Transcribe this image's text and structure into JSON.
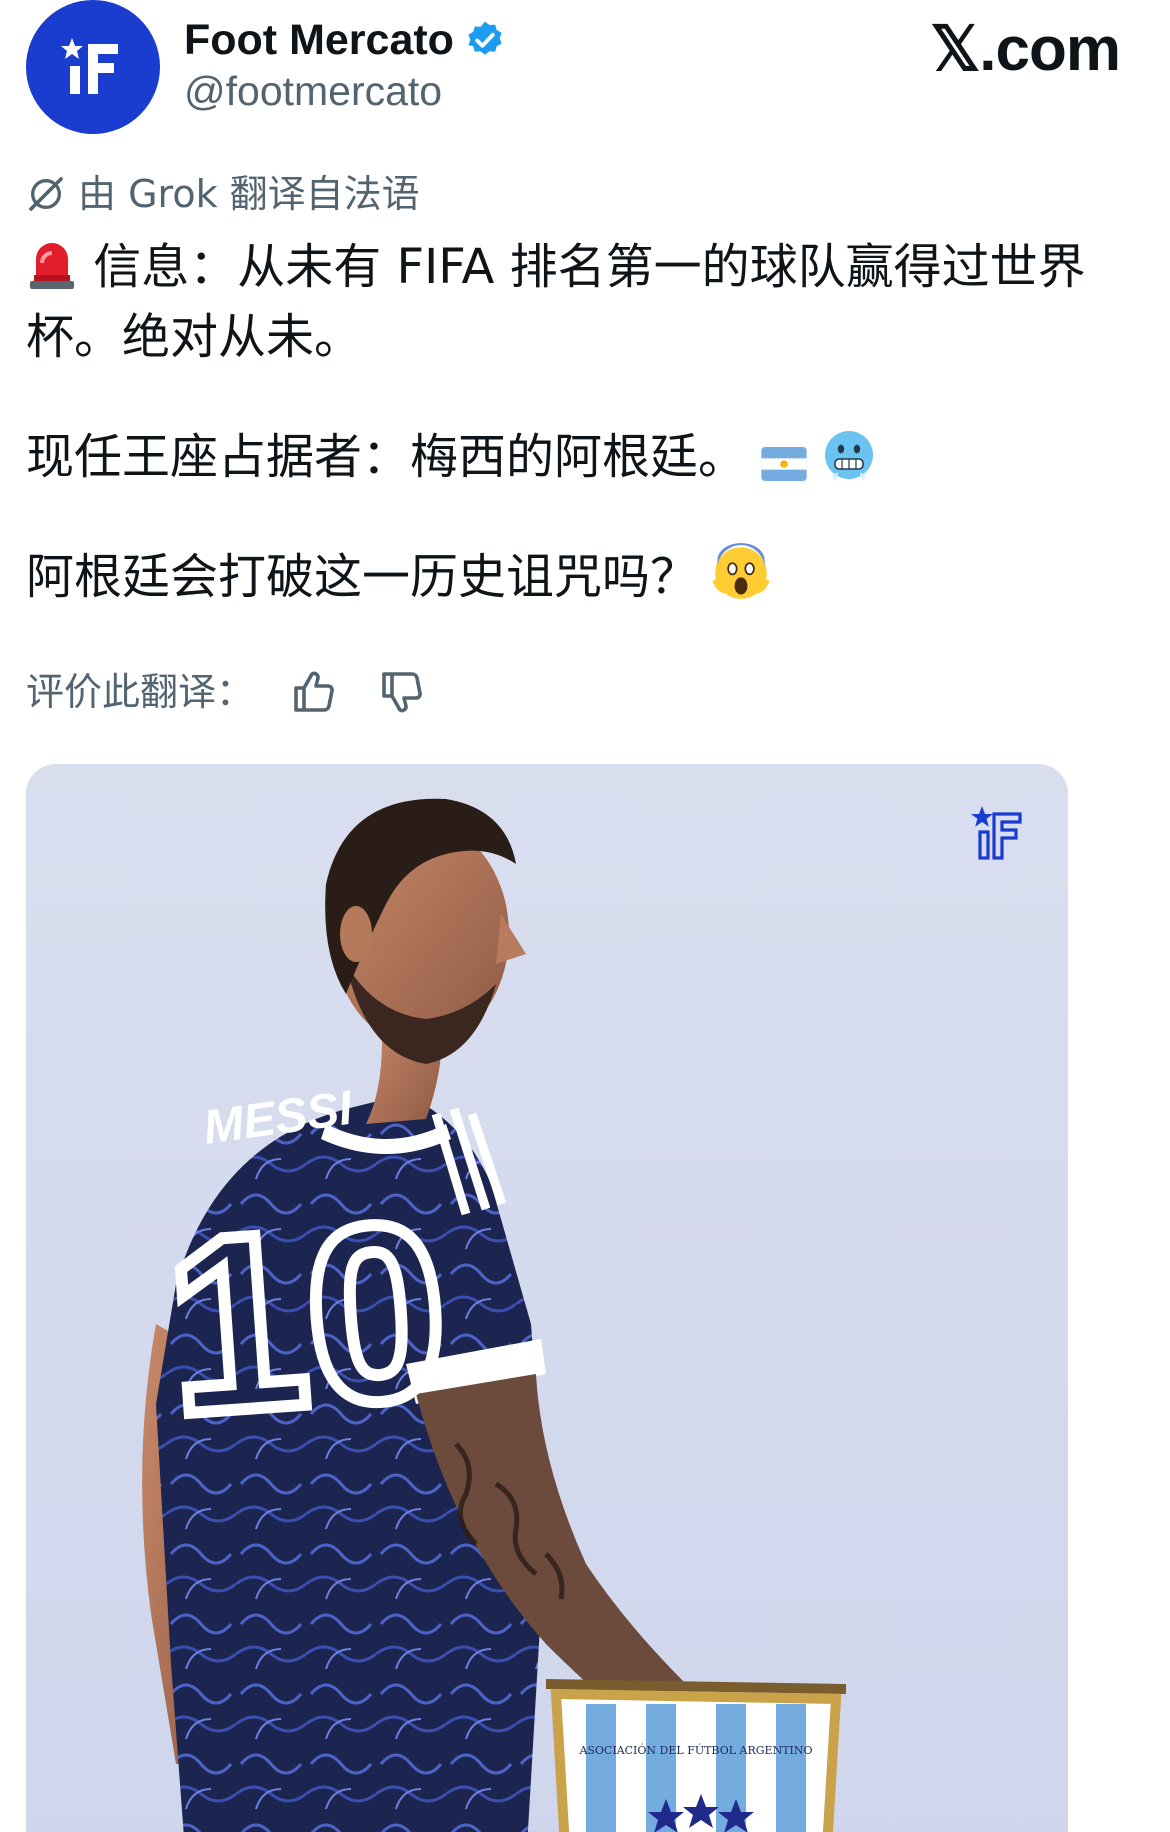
{
  "author": {
    "display_name": "Foot Mercato",
    "handle": "@footmercato",
    "avatar_color": "#1a3ccf",
    "verified": true
  },
  "site": {
    "logo_text": "𝕏.com"
  },
  "translation": {
    "label": "由 Grok 翻译自法语",
    "rate_label": "评价此翻译："
  },
  "tweet": {
    "line1": "信息：从未有 FIFA 排名第一的球队赢得过世界杯。绝对从未。",
    "line2": "现任王座占据者：梅西的阿根廷。",
    "line3": "阿根廷会打破这一历史诅咒吗？"
  },
  "media": {
    "jersey_name": "MESSI",
    "jersey_number": "10",
    "pennant_text": "ASOCIACIÓN DEL FÚTBOL ARGENTINO",
    "background_color": "#d6dcef"
  },
  "icons": {
    "avatar": "foot-mercato-logo",
    "verified": "verified-badge-icon",
    "grok": "grok-icon",
    "siren": "siren-emoji",
    "flag": "argentina-flag-emoji",
    "cold_face": "cold-face-emoji",
    "scream": "screaming-face-emoji",
    "thumbs_up": "thumbs-up-icon",
    "thumbs_down": "thumbs-down-icon"
  }
}
